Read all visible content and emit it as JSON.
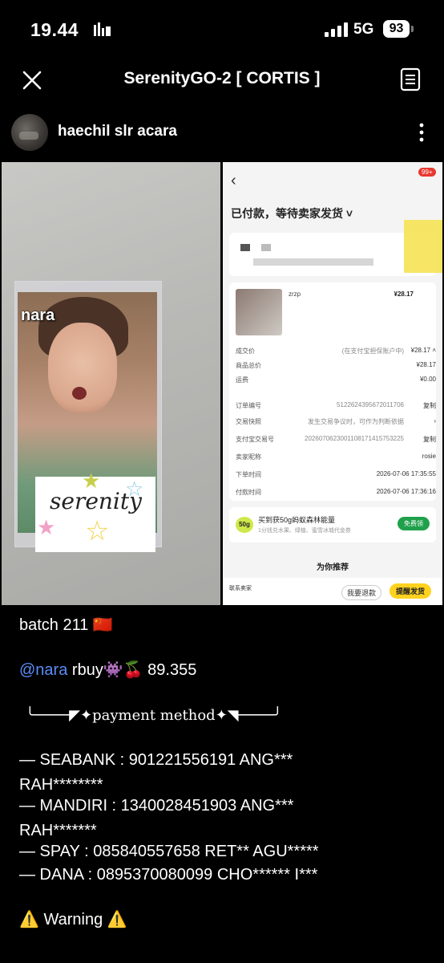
{
  "status_bar": {
    "time": "19.44",
    "network": "5G",
    "battery": "93"
  },
  "header": {
    "title": "SerenityGO-2 [ CORTIS ]"
  },
  "author": {
    "name": "haechil slr acara"
  },
  "photo": {
    "sticker_label": "nara",
    "note_text": "serenity"
  },
  "order_screenshot": {
    "badge": "99+",
    "status": "已付款，等待卖家发货 ˅",
    "seller": "zrzp",
    "price": "¥28.17",
    "rows": [
      {
        "k": "成交价",
        "v": "(在支付宝担保账户中)",
        "a": "¥28.17 ˄"
      },
      {
        "k": "商品总价",
        "v": "",
        "a": "¥28.17"
      },
      {
        "k": "运费",
        "v": "",
        "a": "¥0.00"
      },
      {
        "k": "订单编号",
        "v": "5122624395672011706",
        "a": "复制"
      },
      {
        "k": "交易快照",
        "v": "发生交易争议时，可作为判断依据",
        "a": "›"
      },
      {
        "k": "支付宝交易号",
        "v": "2026070623001108171415753225",
        "a": "复制"
      },
      {
        "k": "卖家昵称",
        "v": "",
        "a": "rosie"
      },
      {
        "k": "下单时间",
        "v": "",
        "a": "2026-07-06 17:35:55"
      },
      {
        "k": "付款时间",
        "v": "",
        "a": "2026-07-06 17:36:16"
      }
    ],
    "promo_badge": "50g",
    "promo_title": "买到获50g蚂蚁森林能量",
    "promo_sub": "1分钱兑水果、绿植、蜜雪冰城代金券",
    "promo_button": "免费领",
    "recommend": "为你推荐",
    "contact": "联系卖家",
    "refund": "我要退款",
    "remind": "提醒发货"
  },
  "caption": {
    "batch": "batch 211 🇨🇳",
    "mention": "@nara",
    "rbuy": "rbuy👾🍒 89.355",
    "payment_method": "╰────◤✦payment method✦◥────╯",
    "seabank_1": "— SEABANK : 901221556191 ANG***",
    "seabank_2": "RAH********",
    "mandiri_1": "— MANDIRI : 1340028451903 ANG***",
    "mandiri_2": "RAH*******",
    "spay": "— SPAY : 085840557658 RET** AGU*****",
    "dana": "— DANA : 0895370080099 CHO****** I***",
    "warning": "⚠️ Warning ⚠️"
  }
}
